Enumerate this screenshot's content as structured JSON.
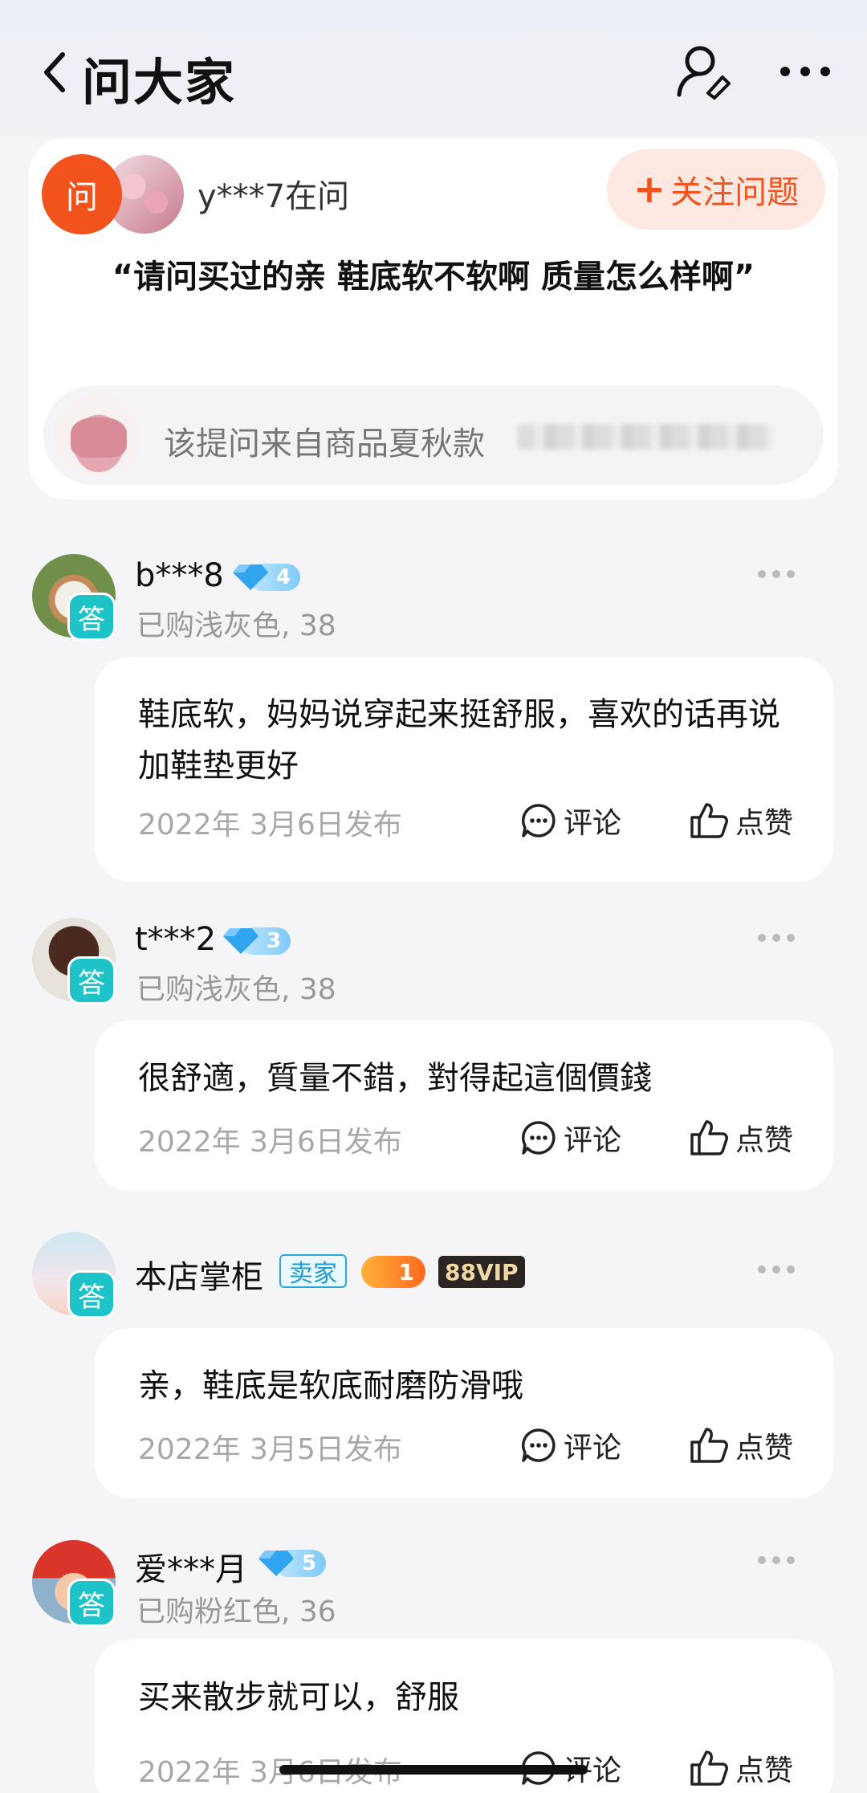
{
  "header": {
    "title": "问大家",
    "back_icon": "chevron-left-icon",
    "user_search_icon": "user-search-icon",
    "more_icon": "more-dots-icon"
  },
  "question": {
    "badge": "问",
    "asker": "y***7在问",
    "follow_label": "关注问题",
    "text": "“请问买过的亲 鞋底软不软啊 质量怎么样啊”",
    "product_prefix": "该提问来自商品夏秋款",
    "accent_color": "#f2531d"
  },
  "answers": [
    {
      "badge": "答",
      "name": "b***8",
      "level": "4",
      "purchase": "已购浅灰色, 38",
      "content": "鞋底软，妈妈说穿起来挺舒服，喜欢的话再说加鞋垫更好",
      "date": "2022年 3月6日发布",
      "comment_label": "评论",
      "like_label": "点赞"
    },
    {
      "badge": "答",
      "name": "t***2",
      "level": "3",
      "purchase": "已购浅灰色, 38",
      "content": "很舒適，質量不錯，對得起這個價錢",
      "date": "2022年 3月6日发布",
      "comment_label": "评论",
      "like_label": "点赞"
    },
    {
      "badge": "答",
      "name": "本店掌柜",
      "seller_tag": "卖家",
      "level": "1",
      "vip": "88VIP",
      "content": "亲，鞋底是软底耐磨防滑哦",
      "date": "2022年 3月5日发布",
      "comment_label": "评论",
      "like_label": "点赞"
    },
    {
      "badge": "答",
      "name": "爱***月",
      "level": "5",
      "purchase": "已购粉红色, 36",
      "content": "买来散步就可以，舒服",
      "date": "2022年 3月6日发布",
      "comment_label": "评论",
      "like_label": "点赞"
    }
  ]
}
